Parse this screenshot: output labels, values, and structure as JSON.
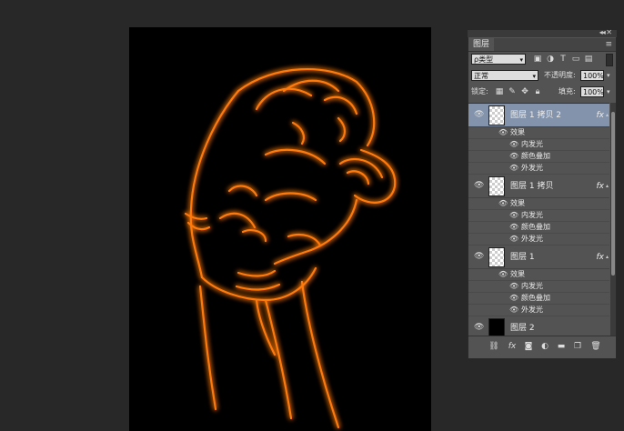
{
  "canvas": {
    "background": "#000000",
    "glow_color": "#ff5a00"
  },
  "panel": {
    "tab_label": "图层",
    "menu_icon": "panel-menu-icon",
    "filter": {
      "label": "ρ类型",
      "icons": [
        "image-filter-icon",
        "adjustment-filter-icon",
        "type-filter-icon",
        "shape-filter-icon",
        "smart-object-filter-icon"
      ]
    },
    "blend": {
      "mode": "正常",
      "opacity_label": "不透明度:",
      "opacity_value": "100%"
    },
    "lock": {
      "label": "锁定:",
      "fill_label": "填充:",
      "fill_value": "100%"
    },
    "layers": [
      {
        "name": "图层 1 拷贝 2",
        "fx": "fx",
        "selected": true,
        "effects_label": "效果",
        "effects": [
          "内发光",
          "颜色叠加",
          "外发光"
        ]
      },
      {
        "name": "图层 1 拷贝",
        "fx": "fx",
        "selected": false,
        "effects_label": "效果",
        "effects": [
          "内发光",
          "颜色叠加",
          "外发光"
        ]
      },
      {
        "name": "图层 1",
        "fx": "fx",
        "selected": false,
        "effects_label": "效果",
        "effects": [
          "内发光",
          "颜色叠加",
          "外发光"
        ]
      },
      {
        "name": "图层 2",
        "fx": "",
        "selected": false
      }
    ],
    "footer_icons": [
      "link-layers-icon",
      "fx-icon",
      "mask-icon",
      "adjustment-icon",
      "folder-icon",
      "new-layer-icon",
      "trash-icon"
    ]
  }
}
